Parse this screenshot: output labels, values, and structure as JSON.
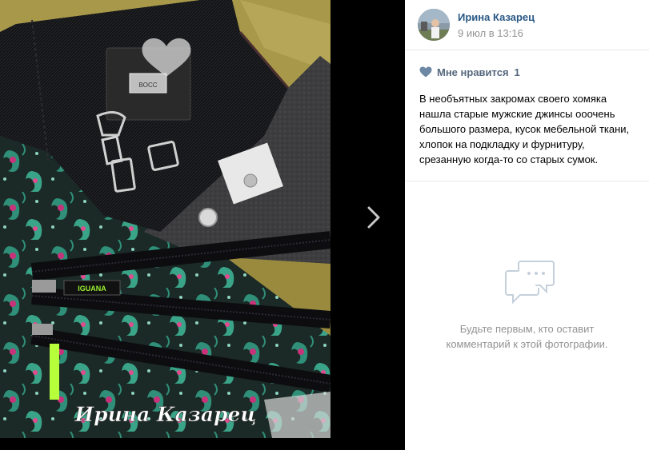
{
  "viewer": {
    "watermark": "Ирина Казарец",
    "next_icon": "chevron-right-icon",
    "label_text": "BOCC",
    "zipper_brand": "IGUANA"
  },
  "author": {
    "name": "Ирина Казарец",
    "date": "9 июл в 13:16"
  },
  "likes": {
    "label": "Мне нравится",
    "count": "1",
    "icon": "heart-icon"
  },
  "description": {
    "lines": [
      "В необъятных закромах своего хомяка",
      "нашла старые мужские джинсы ооочень",
      "большого размера, кусок мебельной ткани,",
      "хлопок на подкладку и фурнитуру,",
      "срезанную когда-то со старых сумок."
    ]
  },
  "comments": {
    "empty_icon": "comments-icon",
    "empty_line1": "Будьте первым, кто оставит",
    "empty_line2": "комментарий к этой фотографии."
  },
  "colors": {
    "link": "#2a5885",
    "muted": "#939393",
    "like": "#55677d",
    "separator": "#e7e8ec"
  }
}
